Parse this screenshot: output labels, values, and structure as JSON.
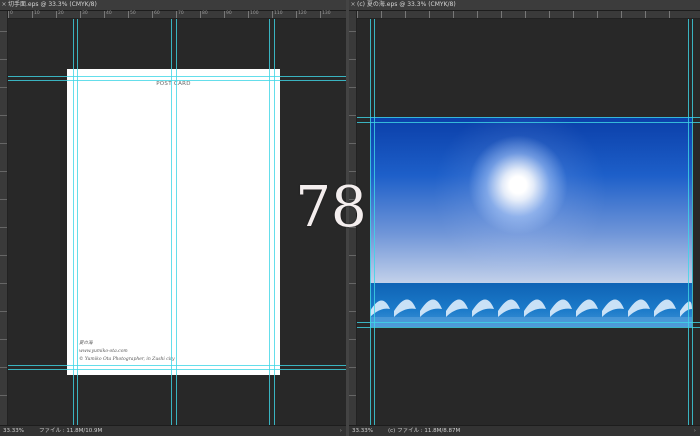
{
  "left_document": {
    "tab_title": "切手面.eps @ 33.3% (CMYK/8)",
    "ruler_labels": [
      "0",
      "10",
      "20",
      "30",
      "40",
      "50",
      "60",
      "70",
      "80",
      "90",
      "100",
      "110",
      "120",
      "130"
    ],
    "postcard": {
      "title": "POST CARD",
      "credit_line1": "夏の海",
      "credit_line2": "www.yumiko-ota.com",
      "credit_line3": "© Yumiko Ota Photographer, in Zushi city"
    },
    "status": {
      "zoom": "33.33%",
      "info": "ファイル : 11.8M/10.9M"
    }
  },
  "right_document": {
    "tab_title": "(c) 夏の海.eps @ 33.3% (CMYK/8)",
    "photo": {
      "sky_top_color": "#0a3ea8",
      "sky_bottom_color": "#c3d1ea",
      "sea_color": "#1b7ac9"
    },
    "status": {
      "zoom": "33.33%",
      "info": "(c) ファイル : 11.8M/8.87M"
    }
  },
  "overlay": {
    "page_number": "78"
  },
  "colors": {
    "guide": "#3fd6e6",
    "canvas_bg": "#282828"
  }
}
